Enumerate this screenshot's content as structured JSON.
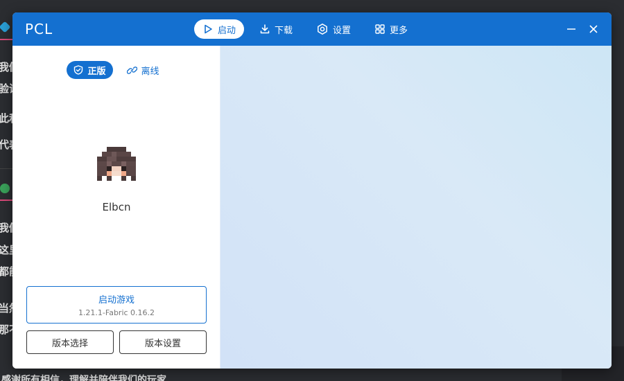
{
  "background": {
    "lines": [
      {
        "text": "我們"
      },
      {
        "text": "验证"
      },
      {
        "text": "此和"
      },
      {
        "text": "代表"
      },
      {
        "text": "我們"
      },
      {
        "text": "这里"
      },
      {
        "text": "都能"
      },
      {
        "text": "当然"
      },
      {
        "text": "那不"
      }
    ],
    "bottom_text": "感谢所有相信，理解并陪伴我们的玩家"
  },
  "window": {
    "logo": "PCL",
    "nav": [
      {
        "label": "启动",
        "icon": "play-icon",
        "active": true
      },
      {
        "label": "下载",
        "icon": "download-icon",
        "active": false
      },
      {
        "label": "设置",
        "icon": "settings-icon",
        "active": false
      },
      {
        "label": "更多",
        "icon": "grid-icon",
        "active": false
      }
    ],
    "controls": {
      "minimize": "minimize-icon",
      "close": "close-icon"
    }
  },
  "left_panel": {
    "modes": [
      {
        "label": "正版",
        "icon": "shield-check-icon",
        "active": true
      },
      {
        "label": "离线",
        "icon": "link-icon",
        "active": false
      }
    ],
    "username": "Elbcn",
    "launch": {
      "title": "启动游戏",
      "version": "1.21.1-Fabric 0.16.2"
    },
    "version_select": "版本选择",
    "version_settings": "版本设置"
  },
  "colors": {
    "accent": "#1470d0",
    "titlebar": "#1470d0"
  }
}
